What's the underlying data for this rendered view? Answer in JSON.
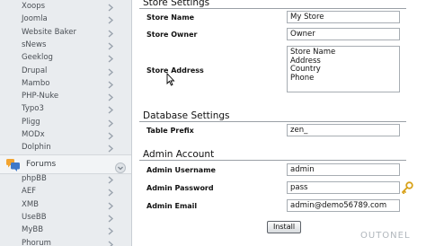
{
  "sidebar": {
    "items_top": [
      {
        "label": "Xoops"
      },
      {
        "label": "Joomla"
      },
      {
        "label": "Website Baker"
      },
      {
        "label": "sNews"
      },
      {
        "label": "Geeklog"
      },
      {
        "label": "Drupal"
      },
      {
        "label": "Mambo"
      },
      {
        "label": "PHP-Nuke"
      },
      {
        "label": "Typo3"
      },
      {
        "label": "Pligg"
      },
      {
        "label": "MODx"
      },
      {
        "label": "Dolphin"
      }
    ],
    "section": {
      "label": "Forums",
      "icon": "forums-icon"
    },
    "items_bottom": [
      {
        "label": "phpBB"
      },
      {
        "label": "AEF"
      },
      {
        "label": "XMB"
      },
      {
        "label": "UseBB"
      },
      {
        "label": "MyBB"
      },
      {
        "label": "Phorum"
      }
    ]
  },
  "store_settings": {
    "title": "Store Settings",
    "store_name_label": "Store Name",
    "store_name_value": "My Store",
    "store_owner_label": "Store Owner",
    "store_owner_value": "Owner",
    "store_address_label": "Store Address",
    "store_address_value": "Store Name\nAddress\nCountry\nPhone"
  },
  "database_settings": {
    "title": "Database Settings",
    "table_prefix_label": "Table Prefix",
    "table_prefix_value": "zen_"
  },
  "admin_account": {
    "title": "Admin Account",
    "username_label": "Admin Username",
    "username_value": "admin",
    "password_label": "Admin Password",
    "password_value": "pass",
    "email_label": "Admin Email",
    "email_value": "admin@demo56789.com"
  },
  "actions": {
    "install_label": "Install"
  },
  "watermark": "OUTONEL",
  "colors": {
    "sidebar_bg": "#e9ecef",
    "chevron": "#9aa3ad",
    "forums_icon": "#3f78c9"
  }
}
